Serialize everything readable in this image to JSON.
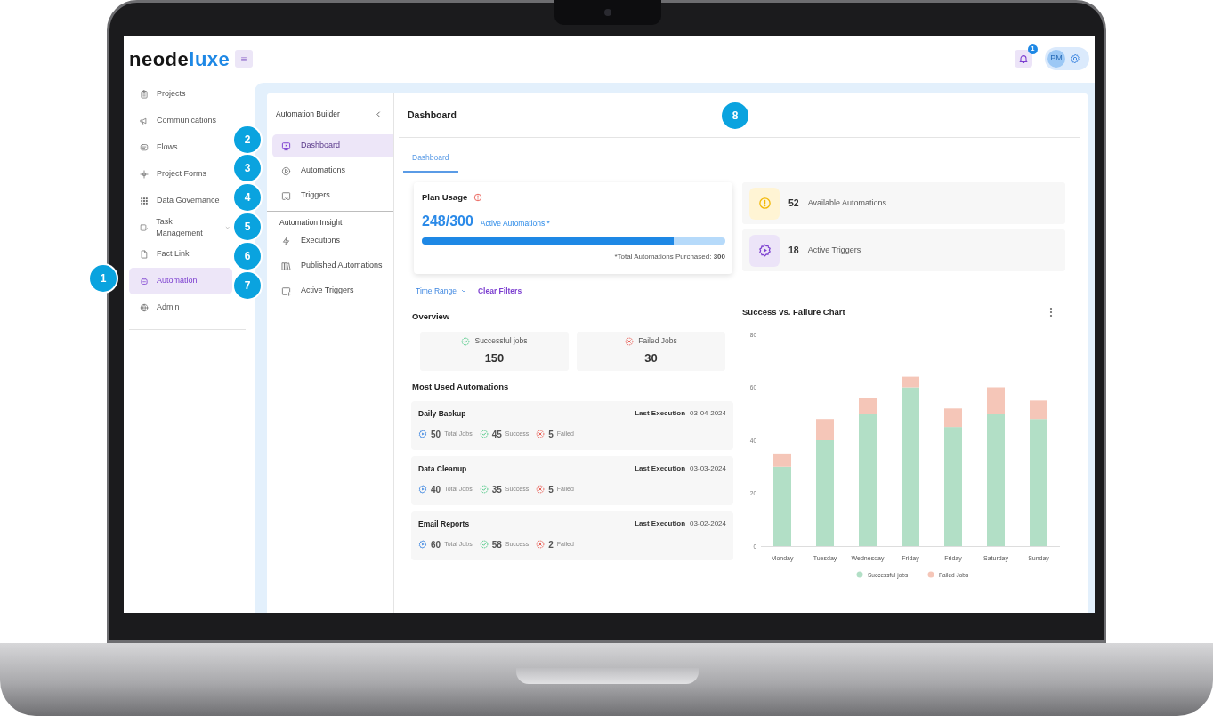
{
  "brand": {
    "parts": [
      {
        "text": "neode",
        "kind": "plain"
      },
      {
        "text": "luxe",
        "kind": "accent"
      }
    ]
  },
  "header": {
    "notification_count": "1",
    "user_initials": "PM"
  },
  "sidebar": {
    "items": [
      {
        "label": "Projects",
        "selected": false,
        "expandable": false
      },
      {
        "label": "Communications",
        "selected": false,
        "expandable": false
      },
      {
        "label": "Flows",
        "selected": false,
        "expandable": false
      },
      {
        "label": "Project Forms",
        "selected": false,
        "expandable": false
      },
      {
        "label": "Data Governance",
        "selected": false,
        "expandable": false
      },
      {
        "label": "Task Management",
        "selected": false,
        "expandable": true
      },
      {
        "label": "Fact Link",
        "selected": false,
        "expandable": false
      },
      {
        "label": "Automation",
        "selected": true,
        "expandable": false
      },
      {
        "label": "Admin",
        "selected": false,
        "expandable": false
      }
    ]
  },
  "builder": {
    "title": "Automation Builder",
    "sections": [
      {
        "items": [
          {
            "label": "Dashboard",
            "selected": true
          },
          {
            "label": "Automations",
            "selected": false
          },
          {
            "label": "Triggers",
            "selected": false
          }
        ]
      },
      {
        "heading": "Automation Insight",
        "items": [
          {
            "label": "Executions",
            "selected": false
          },
          {
            "label": "Published Automations",
            "selected": false
          },
          {
            "label": "Active Triggers",
            "selected": false
          }
        ]
      }
    ]
  },
  "page": {
    "title": "Dashboard",
    "tabs": [
      {
        "label": "Dashboard",
        "selected": true
      }
    ]
  },
  "plan_usage": {
    "title": "Plan Usage",
    "used": "248/300",
    "used_label": "Active Automations *",
    "level": 0.83,
    "footnote_label": "*Total Automations Purchased:",
    "footnote_value": "300"
  },
  "stats": [
    {
      "kind": "warning",
      "value": "52",
      "label": "Available Automations"
    },
    {
      "kind": "trigger",
      "value": "18",
      "label": "Active Triggers"
    }
  ],
  "filters": {
    "time_range": "Time Range",
    "clear": "Clear Filters"
  },
  "overview": {
    "title": "Overview",
    "cards": [
      {
        "kind": "success",
        "label": "Successful jobs",
        "value": "150"
      },
      {
        "kind": "failed",
        "label": "Failed Jobs",
        "value": "30"
      }
    ]
  },
  "most_used": {
    "title": "Most Used Automations",
    "rows": [
      {
        "name": "Daily Backup",
        "last_label": "Last Execution",
        "date": "03-04-2024",
        "total": "50",
        "total_label": "Total Jobs",
        "success": "45",
        "success_label": "Success",
        "failed": "5",
        "failed_label": "Failed"
      },
      {
        "name": "Data Cleanup",
        "last_label": "Last Execution",
        "date": "03-03-2024",
        "total": "40",
        "total_label": "Total Jobs",
        "success": "35",
        "success_label": "Success",
        "failed": "5",
        "failed_label": "Failed"
      },
      {
        "name": "Email Reports",
        "last_label": "Last Execution",
        "date": "03-02-2024",
        "total": "60",
        "total_label": "Total Jobs",
        "success": "58",
        "success_label": "Success",
        "failed": "2",
        "failed_label": "Failed"
      }
    ]
  },
  "chart": {
    "title": "Success vs. Failure Chart",
    "chart_data": {
      "type": "bar",
      "stacked": true,
      "categories": [
        "Monday",
        "Tuesday",
        "Wednesday",
        "Friday",
        "Friday",
        "Saturday",
        "Sunday"
      ],
      "ylim": [
        0,
        80
      ],
      "legend": "bottom",
      "yticks": [
        0,
        20,
        40,
        60,
        80
      ],
      "series": [
        {
          "name": "Successful jobs",
          "color": "#b2dfc6",
          "values": [
            30,
            40,
            50,
            60,
            45,
            50,
            48
          ]
        },
        {
          "name": "Failed Jobs",
          "color": "#f5c6b8",
          "values": [
            5,
            8,
            6,
            4,
            7,
            10,
            7
          ]
        }
      ]
    }
  },
  "callouts": [
    {
      "label": "1"
    },
    {
      "label": "2"
    },
    {
      "label": "3"
    },
    {
      "label": "4"
    },
    {
      "label": "5"
    },
    {
      "label": "6"
    },
    {
      "label": "7"
    },
    {
      "label": "8"
    }
  ]
}
